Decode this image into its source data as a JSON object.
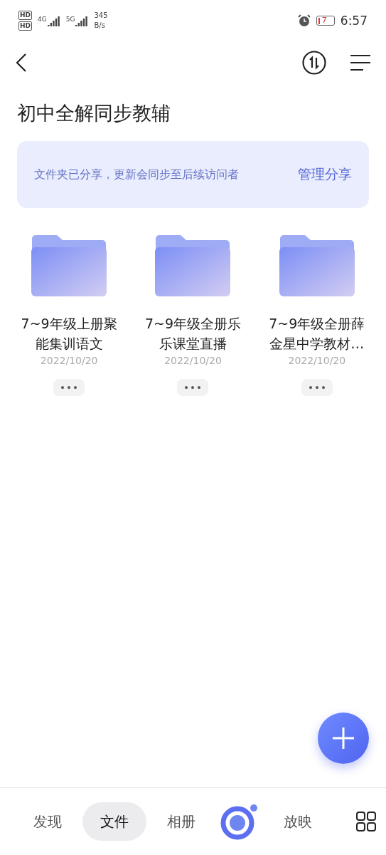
{
  "status_bar": {
    "sim_labels": [
      "HD",
      "HD"
    ],
    "networks": [
      {
        "label": "4G"
      },
      {
        "label": "5G"
      }
    ],
    "speed": "345",
    "speed_unit": "B/s",
    "battery": "7",
    "battery_low": true,
    "time": "6:57"
  },
  "title": "初中全解同步教辅",
  "share_banner": {
    "text": "文件夹已分享，更新会同步至后续访问者",
    "action": "管理分享"
  },
  "folders": [
    {
      "name": "7~9年级上册聚能集训语文",
      "date": "2022/10/20"
    },
    {
      "name": "7~9年级全册乐乐课堂直播",
      "date": "2022/10/20"
    },
    {
      "name": "7~9年级全册薛金星中学教材…",
      "date": "2022/10/20"
    }
  ],
  "tabs": [
    {
      "kind": "text",
      "label": "发现",
      "selected": false
    },
    {
      "kind": "text",
      "label": "文件",
      "selected": true
    },
    {
      "kind": "text",
      "label": "相册",
      "selected": false
    },
    {
      "kind": "logo",
      "selected": false
    },
    {
      "kind": "text",
      "label": "放映",
      "selected": false
    }
  ]
}
